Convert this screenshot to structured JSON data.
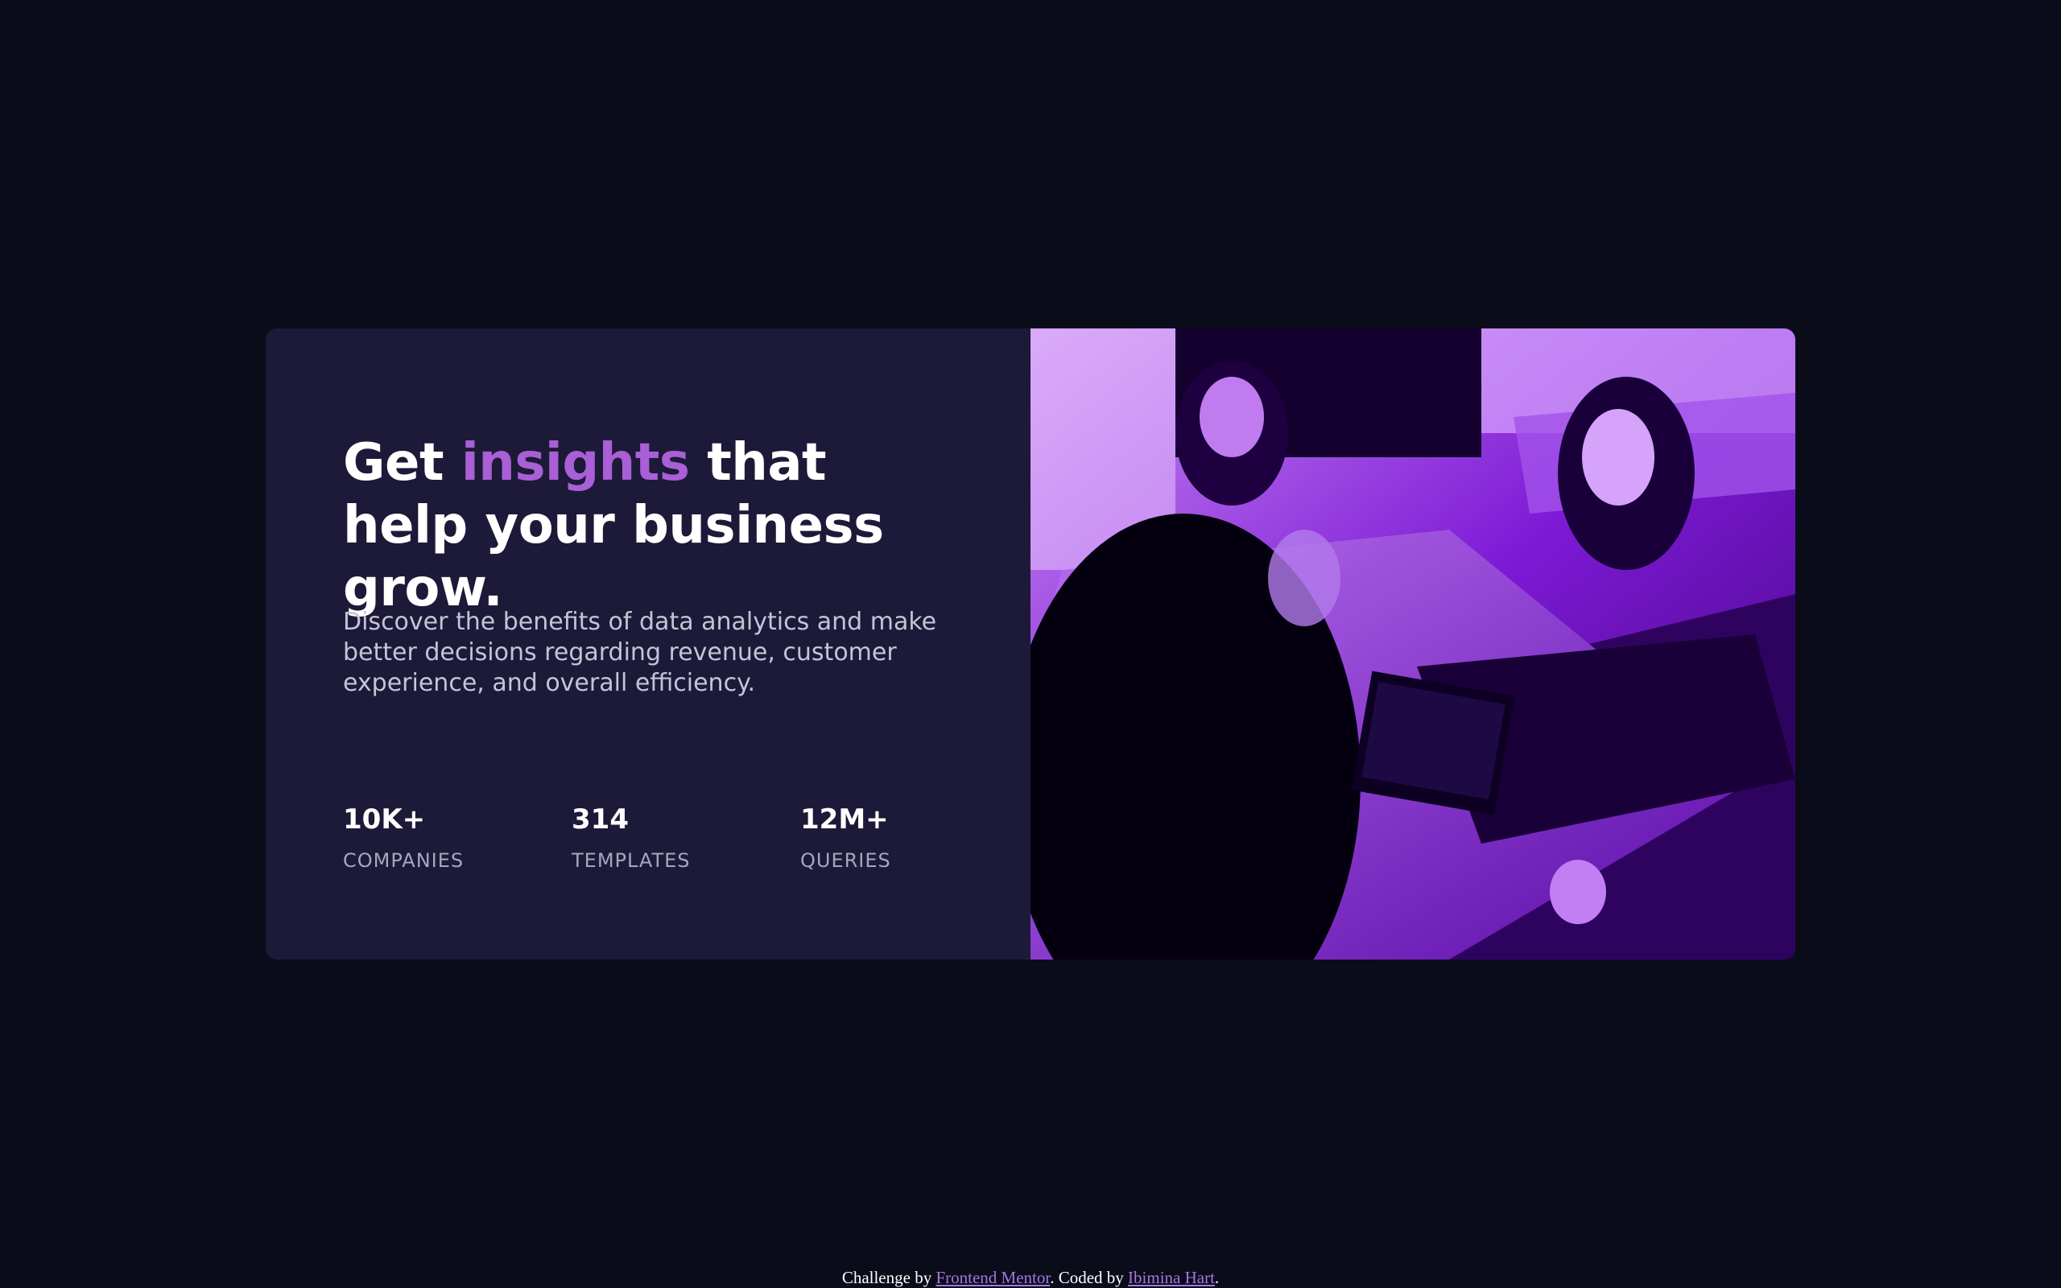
{
  "card": {
    "headline": {
      "before": "Get ",
      "accent": "insights",
      "after": " that help your business grow."
    },
    "description": "Discover the benefits of data analytics and make better decisions regarding revenue, customer experience, and overall efficiency.",
    "stats": [
      {
        "value": "10K+",
        "label": "COMPANIES"
      },
      {
        "value": "314",
        "label": "TEMPLATES"
      },
      {
        "value": "12M+",
        "label": "QUERIES"
      }
    ]
  },
  "footer": {
    "prefix": "Challenge by ",
    "challenge_link": "Frontend Mentor",
    "middle": ". Coded by ",
    "author_link": "Ibimina Hart",
    "suffix": "."
  },
  "colors": {
    "page_background": "#0a0c1a",
    "card_background": "#1c1a38",
    "accent": "#a95fd6",
    "image_tint": "#8a1ee0",
    "link": "#a477e0"
  }
}
